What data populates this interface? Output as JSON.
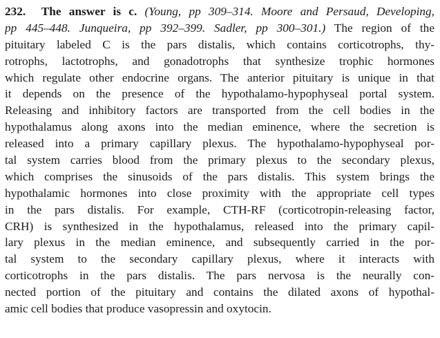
{
  "question_number": "232.",
  "answer_heading": "The answer is c.",
  "lines": [
    {
      "ref": "(Young, pp 309–314. Moore and Persaud, Developing,",
      "text": ""
    },
    {
      "ref": "pp 445–448. Junqueira, pp 392–399. Sadler, pp 300–301.)",
      "text": " The region of the"
    },
    {
      "text": "pituitary labeled C is the pars distalis, which contains corticotrophs, thy-"
    },
    {
      "text": "rotrophs, lactotrophs, and gonadotrophs that synthesize trophic hormones"
    },
    {
      "text": "which regulate other endocrine organs. The anterior pituitary is unique in that"
    },
    {
      "text": "it depends on the presence of the hypothalamo-hypophyseal portal system."
    },
    {
      "text": "Releasing and inhibitory factors are transported from the cell bodies in the"
    },
    {
      "text": "hypothalamus along axons into the median eminence, where the secretion is"
    },
    {
      "text": "released into a primary capillary plexus. The hypothalamo-hypophyseal por-"
    },
    {
      "text": "tal system carries blood from the primary plexus to the secondary plexus,"
    },
    {
      "text": "which comprises the sinusoids of the pars distalis. This system brings the"
    },
    {
      "text": "hypothalamic hormones into close proximity with the appropriate cell types"
    },
    {
      "text": "in the pars distalis. For example, CTH-RF (corticotropin-releasing factor,"
    },
    {
      "text": "CRH) is synthesized in the hypothalamus, released into the primary capil-"
    },
    {
      "text": "lary plexus in the median eminence, and subsequently carried in the por-"
    },
    {
      "text": "tal system to the secondary capillary plexus, where it interacts with"
    },
    {
      "text": "corticotrophs in the pars distalis. The pars nervosa is the neurally con-"
    },
    {
      "text": "nected portion of the pituitary and contains the dilated axons of hypothal-"
    },
    {
      "text": "amic cell bodies that produce vasopressin and oxytocin."
    }
  ]
}
